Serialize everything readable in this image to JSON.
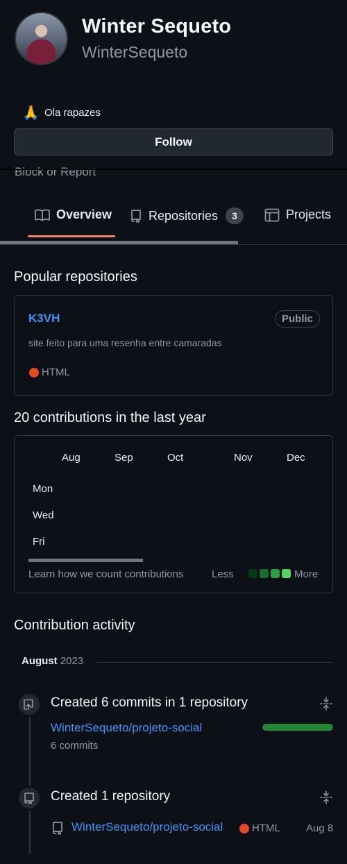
{
  "profile": {
    "full_name": "Winter Sequeto",
    "username": "WinterSequeto",
    "status_emoji": "🙏",
    "status_text": "Ola rapazes",
    "follow_label": "Follow",
    "block_report_label": "Block or Report"
  },
  "tabs": {
    "overview": "Overview",
    "repositories": "Repositories",
    "repositories_count": "3",
    "projects": "Projects",
    "active": "overview"
  },
  "popular": {
    "title": "Popular repositories",
    "repos": [
      {
        "name": "K3VH",
        "visibility": "Public",
        "description": "site feito para uma resenha entre camaradas",
        "language": "HTML",
        "language_color": "#e34c26"
      }
    ]
  },
  "contributions": {
    "title": "20 contributions in the last year",
    "months": [
      "Aug",
      "Sep",
      "Oct",
      "Nov",
      "Dec"
    ],
    "weekdays": [
      "Mon",
      "Wed",
      "Fri"
    ],
    "learn_link": "Learn how we count contributions",
    "legend_less": "Less",
    "legend_more": "More",
    "legend_colors": [
      "#033a16",
      "#196c2e",
      "#2ea043",
      "#56d364"
    ]
  },
  "activity": {
    "title": "Contribution activity",
    "month": "August",
    "year": "2023",
    "events": [
      {
        "title": "Created 6 commits in 1 repository",
        "repo": "WinterSequeto/projeto-social",
        "detail": "6 commits",
        "icon": "repo-push-icon"
      },
      {
        "title": "Created 1 repository",
        "repo": "WinterSequeto/projeto-social",
        "language": "HTML",
        "language_color": "#e34c26",
        "date": "Aug 8",
        "icon": "repo-icon"
      }
    ]
  }
}
